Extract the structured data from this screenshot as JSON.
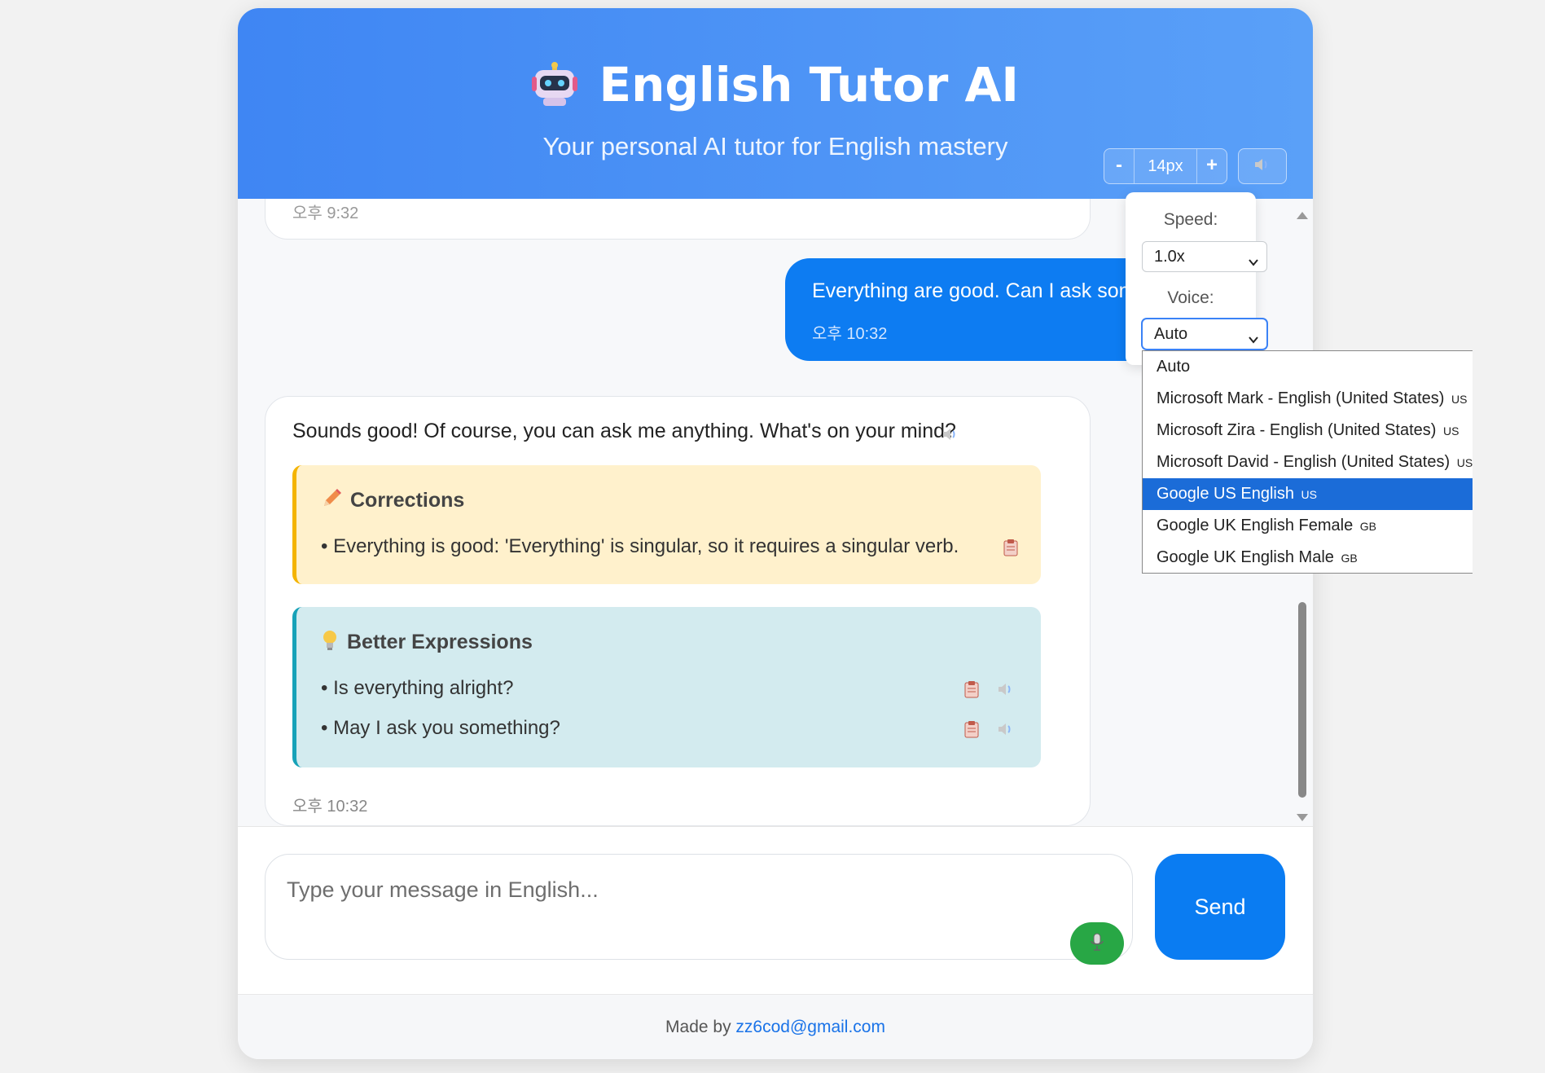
{
  "header": {
    "title": "English Tutor AI",
    "subtitle": "Your personal AI tutor for English mastery",
    "font_size_decrease": "-",
    "font_size_value": "14px",
    "font_size_increase": "+"
  },
  "chat": {
    "previous_message_time": "오후 9:32",
    "user_message": {
      "text": "Everything are good. Can I ask some",
      "time": "오후 10:32"
    },
    "ai_message": {
      "text": "Sounds good! Of course, you can ask me anything. What's on your mind?",
      "corrections_title": "Corrections",
      "corrections": [
        "• Everything is good: 'Everything' is singular, so it requires a singular verb."
      ],
      "better_title": "Better Expressions",
      "better_expressions": [
        "• Is everything alright?",
        "• May I ask you something?"
      ],
      "time": "오후 10:32"
    }
  },
  "input": {
    "placeholder": "Type your message in English...",
    "send_label": "Send"
  },
  "footer": {
    "made_by": "Made by ",
    "email": "zz6cod@gmail.com"
  },
  "tts_settings": {
    "speed_label": "Speed:",
    "speed_value": "1.0x",
    "voice_label": "Voice:",
    "voice_value": "Auto",
    "voice_options": [
      {
        "name": "Auto",
        "code": ""
      },
      {
        "name": "Microsoft Mark - English (United States)",
        "code": "US"
      },
      {
        "name": "Microsoft Zira - English (United States)",
        "code": "US"
      },
      {
        "name": "Microsoft David - English (United States)",
        "code": "US"
      },
      {
        "name": "Google US English",
        "code": "US"
      },
      {
        "name": "Google UK English Female",
        "code": "GB"
      },
      {
        "name": "Google UK English Male",
        "code": "GB"
      }
    ],
    "highlighted_option": "Google US English"
  },
  "colors": {
    "header_gradient_start": "#3f86f3",
    "header_gradient_end": "#5aa0f8",
    "user_bubble": "#0d7cf2",
    "corrections_bg": "#fff1cc",
    "corrections_accent": "#f4b400",
    "better_bg": "#d3ebef",
    "better_accent": "#17a2b8",
    "send_button": "#0a7cf2",
    "mic_button": "#28a745",
    "dropdown_highlight": "#1b6cd8"
  },
  "icons": {
    "logo": "robot-icon",
    "speaker": "speaker-icon",
    "corrections": "pencil-icon",
    "better": "lightbulb-icon",
    "copy": "clipboard-icon",
    "mic": "microphone-icon"
  }
}
